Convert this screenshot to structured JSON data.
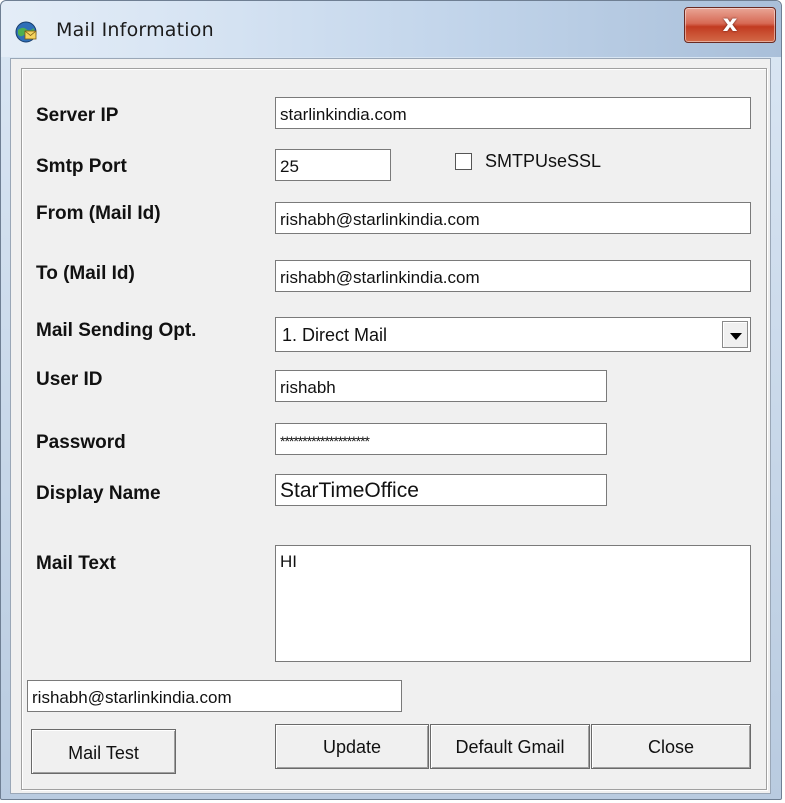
{
  "window": {
    "title": "Mail Information",
    "title_icon": "globe-mail-icon",
    "close_glyph": "x"
  },
  "form": {
    "server_ip_label": "Server IP",
    "server_ip_value": "starlinkindia.com",
    "smtp_port_label": "Smtp Port",
    "smtp_port_value": "25",
    "ssl_label": "SMTPUseSSL",
    "ssl_checked": false,
    "from_label": "From (Mail Id)",
    "from_value": "rishabh@starlinkindia.com",
    "to_label": "To (Mail Id)",
    "to_value": "rishabh@starlinkindia.com",
    "sending_opt_label": "Mail Sending Opt.",
    "sending_opt_value": "1. Direct Mail",
    "user_id_label": "User ID",
    "user_id_value": "rishabh",
    "password_label": "Password",
    "password_value": "********************",
    "display_name_label": "Display Name",
    "display_name_value": "StarTimeOffice",
    "mail_text_label": "Mail Text",
    "mail_text_value": "HI",
    "test_address_value": "rishabh@starlinkindia.com"
  },
  "buttons": {
    "mail_test": "Mail Test",
    "update": "Update",
    "default_gmail": "Default Gmail",
    "close": "Close"
  },
  "colors": {
    "close_button": "#c8452a",
    "dialog_background": "#f0f0f0"
  }
}
